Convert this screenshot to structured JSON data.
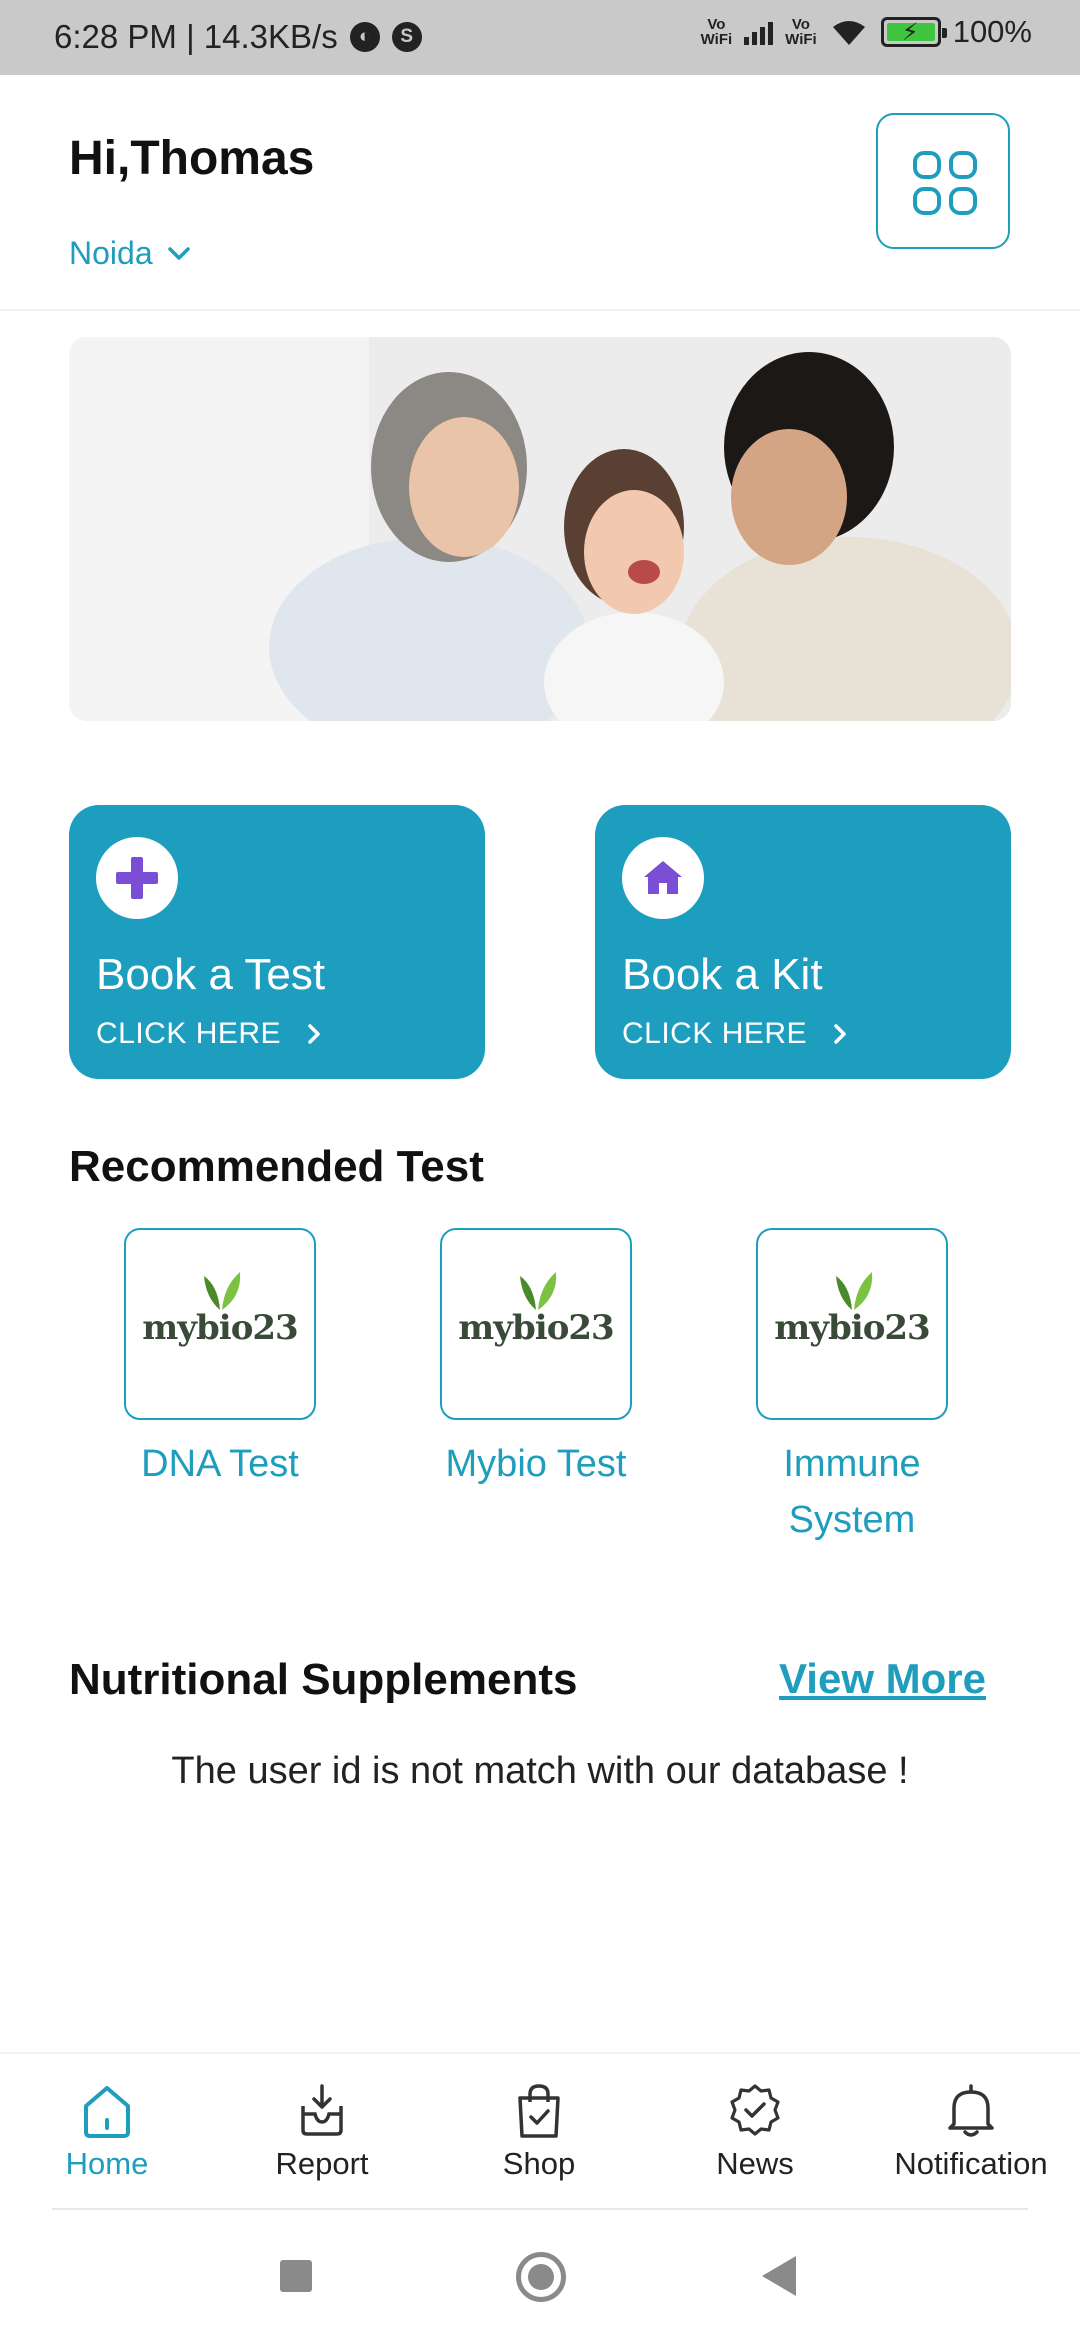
{
  "status_bar": {
    "time_speed": "6:28 PM | 14.3KB/s",
    "badge_s": "S",
    "vowifi_1": "Vo\nWiFi",
    "vowifi_2": "Vo\nWiFi",
    "battery_percent": "100%"
  },
  "header": {
    "greeting": "Hi,Thomas",
    "location": "Noida",
    "menu_icon": "grid-icon"
  },
  "banner": {
    "icon": "family-photo"
  },
  "cards": [
    {
      "title": "Book a Test",
      "cta": "CLICK HERE",
      "icon": "plus-icon"
    },
    {
      "title": "Book a Kit",
      "cta": "CLICK HERE",
      "icon": "home-icon"
    }
  ],
  "recommended": {
    "title": "Recommended Test",
    "logo_text": "mybio23",
    "items": [
      {
        "label": "DNA Test"
      },
      {
        "label": "Mybio Test"
      },
      {
        "label": "Immune System"
      }
    ]
  },
  "nutritional": {
    "title": "Nutritional Supplements",
    "view_more": "View More",
    "message": "The user id is not match with our database !"
  },
  "bottom_nav": {
    "items": [
      {
        "label": "Home",
        "icon": "home-outline-icon",
        "active": true
      },
      {
        "label": "Report",
        "icon": "report-icon",
        "active": false
      },
      {
        "label": "Shop",
        "icon": "shopping-bag-icon",
        "active": false
      },
      {
        "label": "News",
        "icon": "badge-check-icon",
        "active": false
      },
      {
        "label": "Notification",
        "icon": "bell-icon",
        "active": false
      }
    ]
  },
  "colors": {
    "accent": "#1f9dbd",
    "card_bg": "#1e9ebf",
    "icon_purple": "#7a4fd6"
  }
}
